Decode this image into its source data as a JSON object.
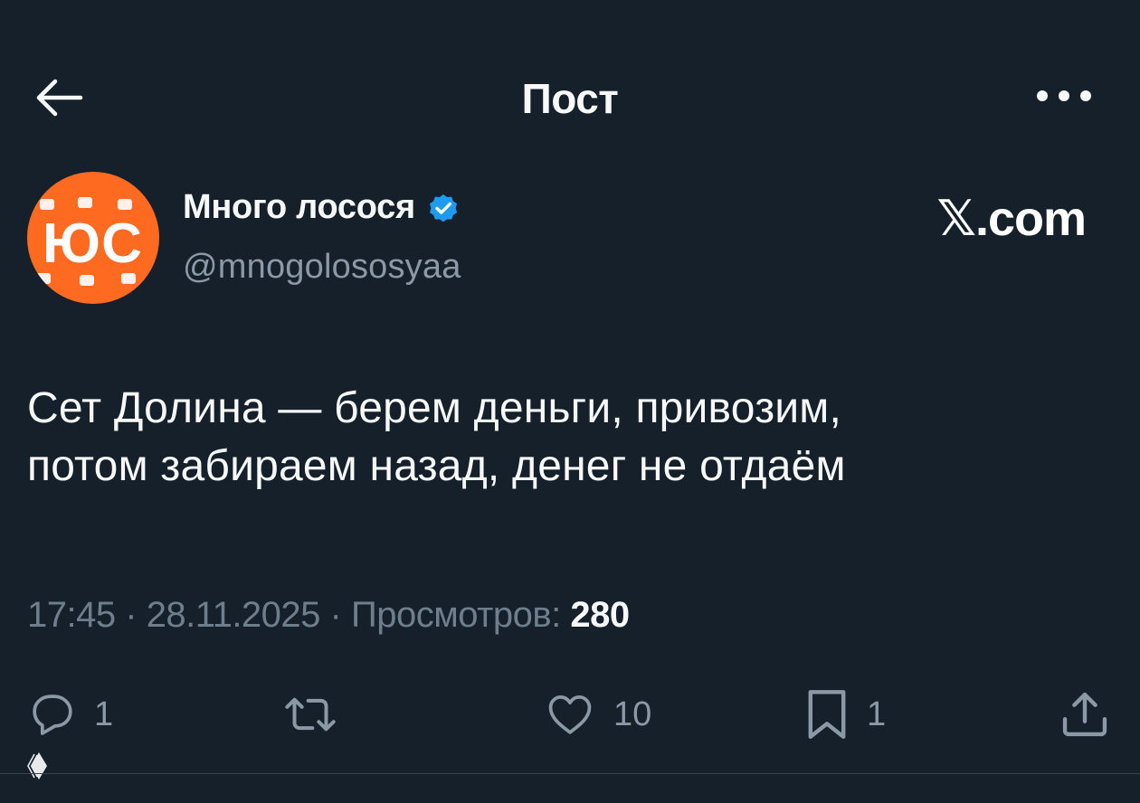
{
  "header": {
    "title": "Пост",
    "back_icon": "arrow-left-icon",
    "more_icon": "more-horizontal-icon"
  },
  "author": {
    "name": "Много лосося",
    "handle": "@mnogolososyaa",
    "verified": true,
    "avatar_text": "ЮС"
  },
  "watermark": "𝕏.com",
  "post": {
    "line1": "Сет Долина — берем деньги, привозим,",
    "line2": "потом забираем назад, денег не отдаём"
  },
  "meta": {
    "time": "17:45",
    "sep1": "·",
    "date": "28.11.2025",
    "sep2": "·",
    "views_label": "Просмотров:",
    "views_count": "280"
  },
  "actions": {
    "reply_count": "1",
    "like_count": "10",
    "bookmark_count": "1"
  },
  "colors": {
    "background": "#15202b",
    "text": "#f7f9f9",
    "secondary": "#8b98a5",
    "verified": "#1d9bf0",
    "avatar": "#ff6a21"
  }
}
